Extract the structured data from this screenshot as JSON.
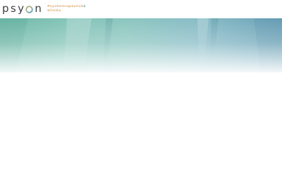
{
  "brand": {
    "wordmark_start": "psy",
    "wordmark_end": "n",
    "tagline_line1_a": "Psychoterapeutick",
    "tagline_line1_b": "á",
    "tagline_line2": "Klinika",
    "logo_icon": "ring-o-icon"
  },
  "colors": {
    "wordmark": "#3a3d40",
    "accent_gold": "#d8a15e",
    "accent_blue": "#4f94b3",
    "hero_teal": "#82c3b6",
    "hero_blue": "#6aa2b8"
  }
}
